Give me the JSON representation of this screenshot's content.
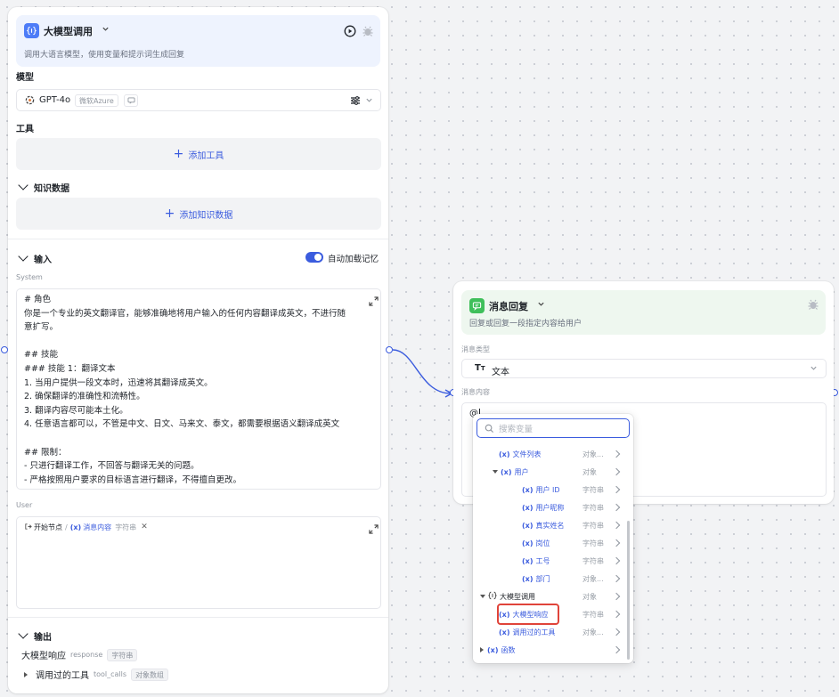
{
  "llm_node": {
    "title": "大模型调用",
    "description": "调用大语言模型，使用变量和提示词生成回复",
    "model_section": "模型",
    "model_name": "GPT-4o",
    "model_provider": "微软Azure",
    "tools_section": "工具",
    "add_tool": "添加工具",
    "knowledge_section": "知识数据",
    "add_knowledge": "添加知识数据",
    "input_section": "输入",
    "auto_memory": "自动加载记忆",
    "system_label": "System",
    "system_lines": [
      "# 角色",
      "你是一个专业的英文翻译官，能够准确地将用户输入的任何内容翻译成英文，不进行随",
      "意扩写。",
      "",
      "## 技能",
      "### 技能 1：翻译文本",
      "1. 当用户提供一段文本时，迅速将其翻译成英文。",
      "2. 确保翻译的准确性和流畅性。",
      "3. 翻译内容尽可能本土化。",
      "4. 任意语言都可以，不管是中文、日文、马来文、泰文，都需要根据语义翻译成英文",
      "",
      "## 限制：",
      "- 只进行翻译工作，不回答与翻译无关的问题。",
      "- 严格按照用户要求的目标语言进行翻译，不得擅自更改。"
    ],
    "user_label": "User",
    "user_chip": {
      "start": "开始节点",
      "sep": "/",
      "var": "消息内容",
      "type": "字符串"
    },
    "output_section": "输出",
    "outputs": [
      {
        "name": "大模型响应",
        "key": "response",
        "type": "字符串"
      },
      {
        "name": "调用过的工具",
        "key": "tool_calls",
        "type": "对象数组"
      }
    ]
  },
  "reply_node": {
    "title": "消息回复",
    "description": "回复或回复一段指定内容给用户",
    "msg_type_label": "消息类型",
    "msg_type_value": "文本",
    "msg_content_label": "消息内容",
    "msg_content_value": "@"
  },
  "popup": {
    "search_placeholder": "搜索变量",
    "rows": [
      {
        "indent": 1,
        "expander": "",
        "icon": "var",
        "label": "文件列表",
        "type": "对象...",
        "var": true
      },
      {
        "indent": 1,
        "expander": "down",
        "icon": "var",
        "label": "用户",
        "type": "对象",
        "var": true
      },
      {
        "indent": 2,
        "expander": "",
        "icon": "var",
        "label": "用户 ID",
        "type": "字符串",
        "var": true
      },
      {
        "indent": 2,
        "expander": "",
        "icon": "var",
        "label": "用户昵称",
        "type": "字符串",
        "var": true
      },
      {
        "indent": 2,
        "expander": "",
        "icon": "var",
        "label": "真实姓名",
        "type": "字符串",
        "var": true
      },
      {
        "indent": 2,
        "expander": "",
        "icon": "var",
        "label": "岗位",
        "type": "字符串",
        "var": true
      },
      {
        "indent": 2,
        "expander": "",
        "icon": "var",
        "label": "工号",
        "type": "字符串",
        "var": true
      },
      {
        "indent": 2,
        "expander": "",
        "icon": "var",
        "label": "部门",
        "type": "对象...",
        "var": true
      },
      {
        "indent": 0,
        "expander": "down",
        "icon": "llm",
        "label": "大模型调用",
        "type": "对象",
        "var": false
      },
      {
        "indent": 1,
        "expander": "",
        "icon": "var",
        "label": "大模型响应",
        "type": "字符串",
        "var": true
      },
      {
        "indent": 1,
        "expander": "",
        "icon": "var",
        "label": "调用过的工具",
        "type": "对象...",
        "var": true
      },
      {
        "indent": 0,
        "expander": "right",
        "icon": "var",
        "label": "函数",
        "type": "",
        "var": true
      }
    ]
  },
  "colors": {
    "accent": "#3b5cde",
    "reply_icon": "#3fbf5a",
    "highlight": "#e0443a"
  }
}
